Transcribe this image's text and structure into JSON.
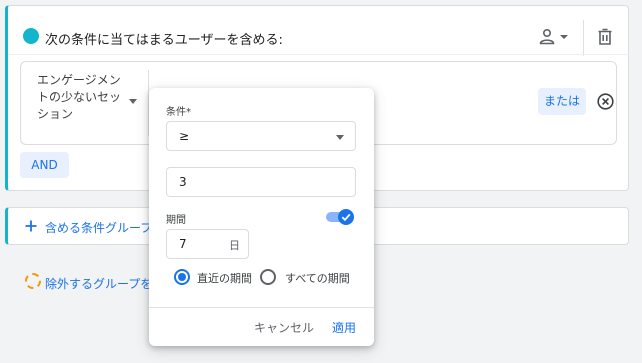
{
  "group": {
    "title": "次の条件に当てはまるユーザーを含める:",
    "metric_label": "エンゲージメントの少ないセッション",
    "or_label": "または",
    "and_label": "AND"
  },
  "add_group": {
    "label": "含める条件グループを"
  },
  "exclude_group": {
    "label": "除外するグループを追"
  },
  "popup": {
    "condition_label": "条件*",
    "operator_value": "≥",
    "number_value": "3",
    "period_label": "期間",
    "period_toggle_on": true,
    "days_value": "7",
    "days_unit": "日",
    "radio_recent": "直近の期間",
    "radio_all": "すべての期間",
    "selected_period": "直近の期間",
    "cancel_label": "キャンセル",
    "apply_label": "適用"
  },
  "colors": {
    "accent_teal": "#12b5cb",
    "primary_blue": "#1a73e8",
    "chip_bg": "#e8f0fe",
    "exclude_orange": "#f29900"
  },
  "icons": {
    "group_dot": "teal-dot-icon",
    "person": "person-icon",
    "delete": "trash-icon",
    "remove": "close-circle-icon",
    "add": "plus-icon",
    "exclude": "dashed-circle-icon",
    "calendar": "calendar-icon"
  }
}
